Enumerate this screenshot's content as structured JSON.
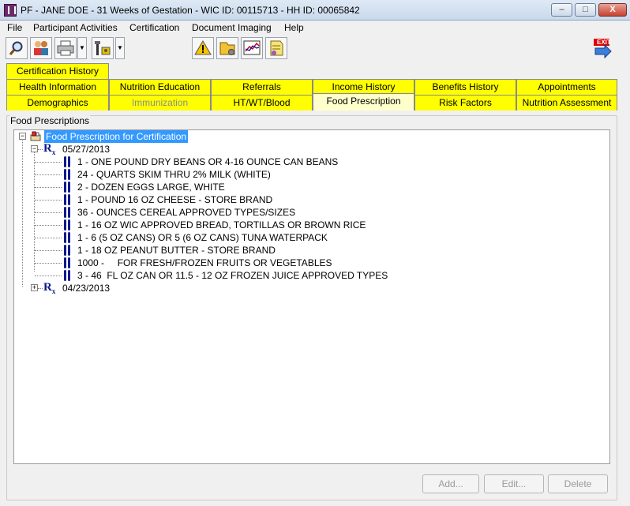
{
  "window": {
    "title": "PF - JANE DOE - 31 Weeks of Gestation - WIC ID: 00115713 - HH ID: 00065842",
    "minimize": "–",
    "maximize": "□",
    "close": "X"
  },
  "menu": [
    "File",
    "Participant Activities",
    "Certification",
    "Document Imaging",
    "Help"
  ],
  "toolbar": {
    "icons": [
      "search-icon",
      "participants-icon",
      "printer-icon",
      "tools-icon",
      "alert-icon",
      "folder-settings-icon",
      "chart-icon",
      "notes-icon",
      "exit-icon"
    ],
    "exit_label": "EXIT"
  },
  "tabs": {
    "row_top": [
      "Certification History"
    ],
    "row_mid": [
      "Health Information",
      "Nutrition Education",
      "Referrals",
      "Income History",
      "Benefits History",
      "Appointments"
    ],
    "row_bottom": [
      "Demographics",
      "Immunization",
      "HT/WT/Blood",
      "Food Prescription",
      "Risk Factors",
      "Nutrition Assessment"
    ],
    "active": "Food Prescription",
    "disabled": [
      "Immunization"
    ]
  },
  "panel": {
    "legend": "Food Prescriptions",
    "root": "Food Prescription for Certification",
    "groups": [
      {
        "date": "05/27/2013",
        "expanded": true,
        "items": [
          "1 - ONE POUND DRY BEANS OR 4-16 OUNCE CAN BEANS",
          "24 - QUARTS SKIM THRU 2% MILK (WHITE)",
          "2 - DOZEN EGGS LARGE, WHITE",
          "1 - POUND 16 OZ CHEESE - STORE BRAND",
          "36 - OUNCES CEREAL APPROVED TYPES/SIZES",
          "1 - 16 OZ WIC APPROVED BREAD, TORTILLAS OR BROWN RICE",
          "1 - 6 (5 OZ CANS) OR 5 (6 OZ CANS) TUNA WATERPACK",
          "1 - 18 OZ PEANUT BUTTER - STORE BRAND",
          "1000 -     FOR FRESH/FROZEN FRUITS OR VEGETABLES",
          "3 - 46  FL OZ CAN OR 11.5 - 12 OZ FROZEN JUICE APPROVED TYPES"
        ]
      },
      {
        "date": "04/23/2013",
        "expanded": false,
        "items": []
      }
    ]
  },
  "buttons": {
    "add": "Add...",
    "edit": "Edit...",
    "delete": "Delete"
  },
  "colors": {
    "tab_yellow": "#ffff00",
    "selection_blue": "#3399ff",
    "rx_blue": "#0b1a8c"
  }
}
